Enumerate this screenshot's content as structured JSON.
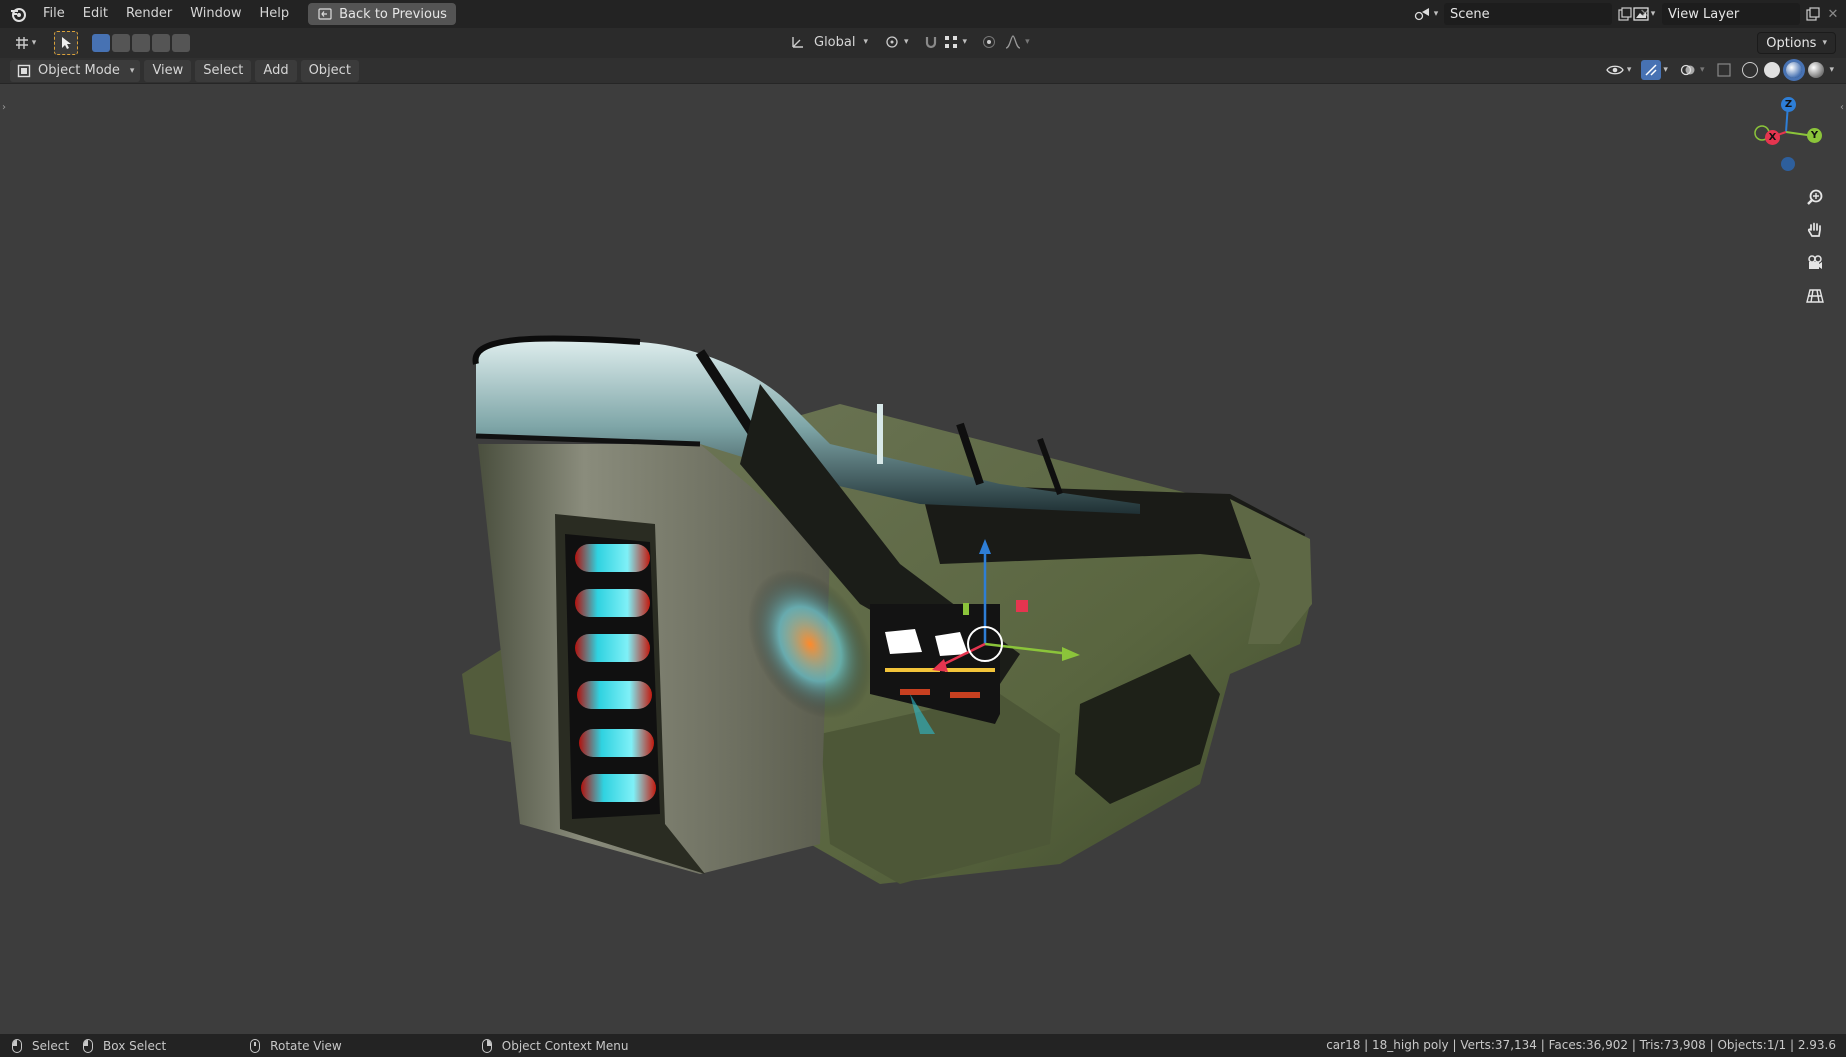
{
  "topbar": {
    "menus": [
      "File",
      "Edit",
      "Render",
      "Window",
      "Help"
    ],
    "back_button": "Back to Previous",
    "scene": "Scene",
    "view_layer": "View Layer"
  },
  "toolbar": {
    "transform_orientation": "Global",
    "options": "Options"
  },
  "header": {
    "mode": "Object Mode",
    "menus": [
      "View",
      "Select",
      "Add",
      "Object"
    ]
  },
  "gizmo": {
    "x": "X",
    "y": "Y",
    "z": "Z"
  },
  "statusbar": {
    "select": "Select",
    "box_select": "Box Select",
    "rotate_view": "Rotate View",
    "context_menu": "Object Context Menu",
    "stats": "car18 | 18_high poly | Verts:37,134 | Faces:36,902 | Tris:73,908 | Objects:1/1 | 2.93.6"
  },
  "icons": [
    "blender-logo-icon",
    "cursor-icon",
    "zoom-icon",
    "hand-icon",
    "camera-icon",
    "grid-icon"
  ],
  "colors": {
    "accent": "#4772b3",
    "axis_x": "#e5354f",
    "axis_y": "#8bc43a",
    "axis_z": "#2e7ed6"
  }
}
